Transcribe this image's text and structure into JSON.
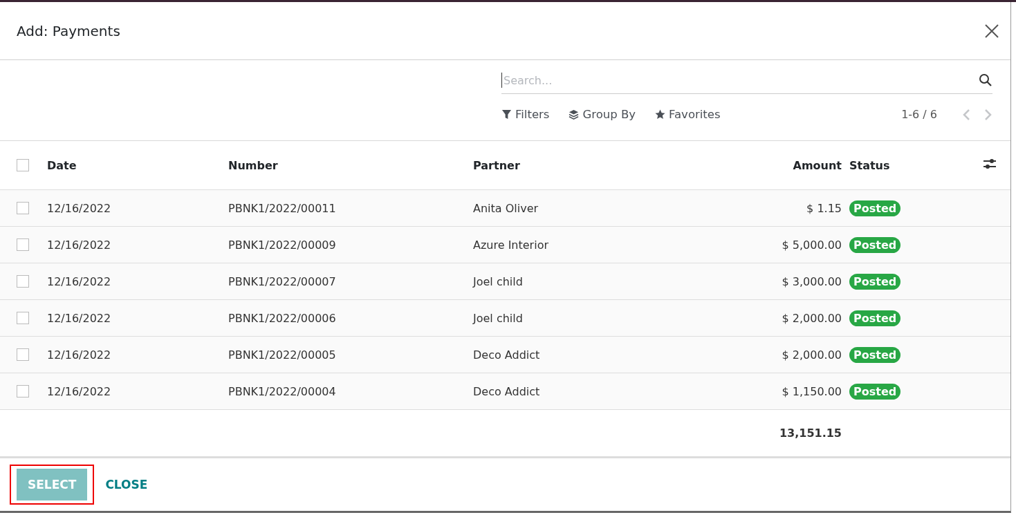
{
  "dialog": {
    "title": "Add: Payments"
  },
  "search": {
    "placeholder": "Search..."
  },
  "toolbar": [
    {
      "kind": "filter",
      "label": "Filters"
    },
    {
      "kind": "group",
      "label": "Group By"
    },
    {
      "kind": "favorite",
      "label": "Favorites"
    }
  ],
  "pager": {
    "text": "1-6 / 6"
  },
  "table": {
    "all_checked": false,
    "columns": [
      {
        "label": "Date"
      },
      {
        "label": "Number"
      },
      {
        "label": "Partner"
      },
      {
        "label": "Amount"
      },
      {
        "label": "Status"
      }
    ],
    "rows": [
      {
        "checked": false,
        "date": "12/16/2022",
        "number": "PBNK1/2022/00011",
        "partner": "Anita Oliver",
        "amount": "$ 1.15",
        "status": "Posted"
      },
      {
        "checked": false,
        "date": "12/16/2022",
        "number": "PBNK1/2022/00009",
        "partner": "Azure Interior",
        "amount": "$ 5,000.00",
        "status": "Posted"
      },
      {
        "checked": false,
        "date": "12/16/2022",
        "number": "PBNK1/2022/00007",
        "partner": "Joel child",
        "amount": "$ 3,000.00",
        "status": "Posted"
      },
      {
        "checked": false,
        "date": "12/16/2022",
        "number": "PBNK1/2022/00006",
        "partner": "Joel child",
        "amount": "$ 2,000.00",
        "status": "Posted"
      },
      {
        "checked": false,
        "date": "12/16/2022",
        "number": "PBNK1/2022/00005",
        "partner": "Deco Addict",
        "amount": "$ 2,000.00",
        "status": "Posted"
      },
      {
        "checked": false,
        "date": "12/16/2022",
        "number": "PBNK1/2022/00004",
        "partner": "Deco Addict",
        "amount": "$ 1,150.00",
        "status": "Posted"
      }
    ],
    "total": "13,151.15"
  },
  "footer": {
    "buttons": [
      {
        "kind": "primary",
        "label": "SELECT",
        "highlighted": true,
        "disabled": true
      },
      {
        "kind": "link",
        "label": "CLOSE",
        "highlighted": false,
        "disabled": false
      }
    ]
  }
}
